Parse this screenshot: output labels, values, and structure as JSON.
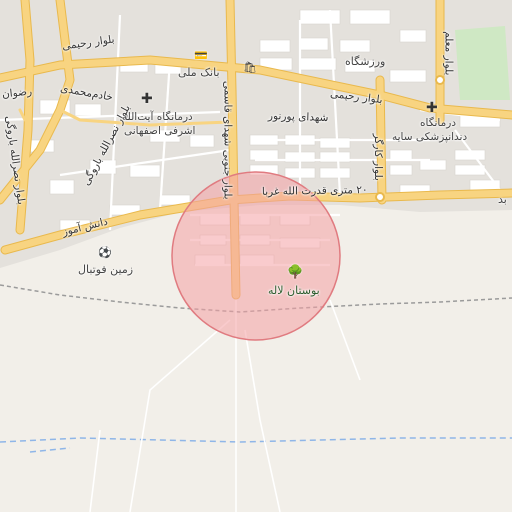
{
  "map": {
    "colors": {
      "background": "#f2efe9",
      "urban": "#e4e1dc",
      "block": "#ffffff",
      "major_road": "#f8d481",
      "major_road_casing": "#e9b94d",
      "park": "#cfe8c4",
      "water_boundary": "#8fb6e8",
      "rail": "#9b9b9b",
      "circle_fill": "#f4a0a4",
      "circle_stroke": "#e07b80"
    },
    "roads": {
      "rahimi_west": "بلوار رحیمی",
      "rahimi_east": "بلوار رحیمی",
      "shohadaye_pournour": "شهدای پورنور",
      "qodratollah": "۲۰ متری قدرت الله غربا",
      "danesh_amooz": "دانش آموز",
      "shahid_ghasemi": "بلوار جنوبی شهدای قاسمی",
      "nasrollah_baroogi": "بلوار نصرالله باروگی",
      "khademmohammadi": "خادم‌محمدی",
      "karegar": "بلوار کارگر",
      "moallem": "بلوار معلم",
      "rezvan": "رضوان"
    },
    "pois": {
      "bank_melli": {
        "label": "بانک ملی",
        "icon": "bank-icon"
      },
      "shop_icon": "shop-icon",
      "varzeshgah": "ورزشگاه",
      "clinic_esfahani": {
        "line1": "درمانگاه آیت‌الله",
        "line2": "اشرفی اصفهانی",
        "icon": "hospital-icon"
      },
      "clinic_saye": {
        "line1": "درمانگاه",
        "line2": "دندانپزشکی سایه",
        "icon": "hospital-icon"
      },
      "football": {
        "label": "زمین فوتبال",
        "icon": "stadium-icon"
      },
      "bostan_laleh": {
        "label": "بوستان لاله",
        "icon": "tree-icon"
      },
      "far_east_fragment": "بد"
    }
  }
}
